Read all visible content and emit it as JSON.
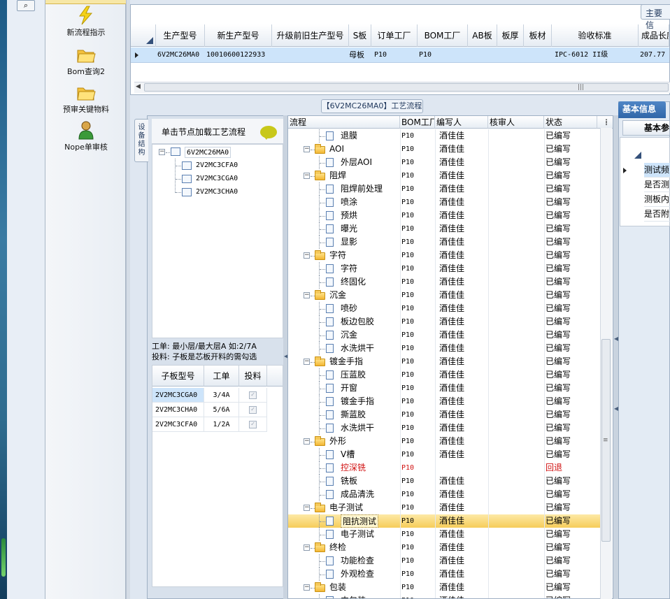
{
  "toolbar_top": {
    "icon": "binoculars-icon"
  },
  "nav": {
    "items": [
      {
        "label": "新流程指示",
        "icon": "lightning-icon"
      },
      {
        "label": "Bom查询2",
        "icon": "folder-open-icon"
      },
      {
        "label": "预审关键物料",
        "icon": "folder-open-icon"
      },
      {
        "label": "Nope单审核",
        "icon": "user-icon"
      }
    ]
  },
  "top_grid": {
    "tab_label": "主要信",
    "columns": [
      "生产型号",
      "新生产型号",
      "升级前旧生产型号",
      "S板",
      "订单工厂",
      "BOM工厂",
      "AB板",
      "板厚",
      "板材",
      "验收标准",
      "成品长度"
    ],
    "row": {
      "生产型号": "6V2MC26MA0",
      "新生产型号": "10010600122933",
      "升级前旧生产型号": "",
      "S板": "母板",
      "订单工厂": "P10",
      "BOM工厂": "P10",
      "AB板": "",
      "板厚": "",
      "板材": "",
      "验收标准": "IPC-6012 II级",
      "成品长度": "207.77"
    }
  },
  "flow_title": "【6V2MC26MA0】工艺流程",
  "left_panel": {
    "vtab_label": "设备结构",
    "tree_header": "单击节点加载工艺流程",
    "tree": {
      "root": "6V2MC26MA0",
      "children": [
        "2V2MC3CFA0",
        "2V2MC3CGA0",
        "2V2MC3CHA0"
      ]
    },
    "note_line1": "工单: 最小层/最大层A 如:2/7A",
    "note_line2": "投料: 子板是芯板开料的需勾选",
    "sub_grid": {
      "columns": [
        "子板型号",
        "工单",
        "投料"
      ],
      "rows": [
        {
          "model": "2V2MC3CGA0",
          "order": "3/4A"
        },
        {
          "model": "2V2MC3CHA0",
          "order": "5/6A"
        },
        {
          "model": "2V2MC3CFA0",
          "order": "1/2A"
        }
      ]
    }
  },
  "flow_grid": {
    "columns": [
      "流程",
      "BOM工厂",
      "编写人",
      "核审人",
      "状态"
    ],
    "rows": [
      {
        "name": "退膜",
        "level": 2,
        "factory": "P10",
        "writer": "酒佳佳",
        "reviewer": "",
        "status": "已编写"
      },
      {
        "name": "AOI",
        "level": 1,
        "factory": "P10",
        "writer": "酒佳佳",
        "reviewer": "",
        "status": "已编写"
      },
      {
        "name": "外层AOI",
        "level": 2,
        "factory": "P10",
        "writer": "酒佳佳",
        "reviewer": "",
        "status": "已编写"
      },
      {
        "name": "阻焊",
        "level": 1,
        "factory": "P10",
        "writer": "酒佳佳",
        "reviewer": "",
        "status": "已编写"
      },
      {
        "name": "阻焊前处理",
        "level": 2,
        "factory": "P10",
        "writer": "酒佳佳",
        "reviewer": "",
        "status": "已编写"
      },
      {
        "name": "喷涂",
        "level": 2,
        "factory": "P10",
        "writer": "酒佳佳",
        "reviewer": "",
        "status": "已编写"
      },
      {
        "name": "预烘",
        "level": 2,
        "factory": "P10",
        "writer": "酒佳佳",
        "reviewer": "",
        "status": "已编写"
      },
      {
        "name": "曝光",
        "level": 2,
        "factory": "P10",
        "writer": "酒佳佳",
        "reviewer": "",
        "status": "已编写"
      },
      {
        "name": "显影",
        "level": 2,
        "factory": "P10",
        "writer": "酒佳佳",
        "reviewer": "",
        "status": "已编写"
      },
      {
        "name": "字符",
        "level": 1,
        "factory": "P10",
        "writer": "酒佳佳",
        "reviewer": "",
        "status": "已编写"
      },
      {
        "name": "字符",
        "level": 2,
        "factory": "P10",
        "writer": "酒佳佳",
        "reviewer": "",
        "status": "已编写"
      },
      {
        "name": "终固化",
        "level": 2,
        "factory": "P10",
        "writer": "酒佳佳",
        "reviewer": "",
        "status": "已编写"
      },
      {
        "name": "沉金",
        "level": 1,
        "factory": "P10",
        "writer": "酒佳佳",
        "reviewer": "",
        "status": "已编写"
      },
      {
        "name": "喷砂",
        "level": 2,
        "factory": "P10",
        "writer": "酒佳佳",
        "reviewer": "",
        "status": "已编写"
      },
      {
        "name": "板边包胶",
        "level": 2,
        "factory": "P10",
        "writer": "酒佳佳",
        "reviewer": "",
        "status": "已编写"
      },
      {
        "name": "沉金",
        "level": 2,
        "factory": "P10",
        "writer": "酒佳佳",
        "reviewer": "",
        "status": "已编写"
      },
      {
        "name": "水洗烘干",
        "level": 2,
        "factory": "P10",
        "writer": "酒佳佳",
        "reviewer": "",
        "status": "已编写"
      },
      {
        "name": "镀金手指",
        "level": 1,
        "factory": "P10",
        "writer": "酒佳佳",
        "reviewer": "",
        "status": "已编写"
      },
      {
        "name": "压蓝胶",
        "level": 2,
        "factory": "P10",
        "writer": "酒佳佳",
        "reviewer": "",
        "status": "已编写"
      },
      {
        "name": "开窗",
        "level": 2,
        "factory": "P10",
        "writer": "酒佳佳",
        "reviewer": "",
        "status": "已编写"
      },
      {
        "name": "镀金手指",
        "level": 2,
        "factory": "P10",
        "writer": "酒佳佳",
        "reviewer": "",
        "status": "已编写"
      },
      {
        "name": "撕蓝胶",
        "level": 2,
        "factory": "P10",
        "writer": "酒佳佳",
        "reviewer": "",
        "status": "已编写"
      },
      {
        "name": "水洗烘干",
        "level": 2,
        "factory": "P10",
        "writer": "酒佳佳",
        "reviewer": "",
        "status": "已编写"
      },
      {
        "name": "外形",
        "level": 1,
        "factory": "P10",
        "writer": "酒佳佳",
        "reviewer": "",
        "status": "已编写"
      },
      {
        "name": "V槽",
        "level": 2,
        "factory": "P10",
        "writer": "酒佳佳",
        "reviewer": "",
        "status": "已编写"
      },
      {
        "name": "控深铣",
        "level": 2,
        "factory": "P10",
        "writer": "",
        "reviewer": "",
        "status": "回退",
        "red": true
      },
      {
        "name": "铣板",
        "level": 2,
        "factory": "P10",
        "writer": "酒佳佳",
        "reviewer": "",
        "status": "已编写"
      },
      {
        "name": "成品清洗",
        "level": 2,
        "factory": "P10",
        "writer": "酒佳佳",
        "reviewer": "",
        "status": "已编写"
      },
      {
        "name": "电子测试",
        "level": 1,
        "factory": "P10",
        "writer": "酒佳佳",
        "reviewer": "",
        "status": "已编写"
      },
      {
        "name": "阻抗测试",
        "level": 2,
        "factory": "P10",
        "writer": "酒佳佳",
        "reviewer": "",
        "status": "已编写",
        "selected": true
      },
      {
        "name": "电子测试",
        "level": 2,
        "factory": "P10",
        "writer": "酒佳佳",
        "reviewer": "",
        "status": "已编写"
      },
      {
        "name": "终检",
        "level": 1,
        "factory": "P10",
        "writer": "酒佳佳",
        "reviewer": "",
        "status": "已编写"
      },
      {
        "name": "功能检查",
        "level": 2,
        "factory": "P10",
        "writer": "酒佳佳",
        "reviewer": "",
        "status": "已编写"
      },
      {
        "name": "外观检查",
        "level": 2,
        "factory": "P10",
        "writer": "酒佳佳",
        "reviewer": "",
        "status": "已编写"
      },
      {
        "name": "包装",
        "level": 1,
        "factory": "P10",
        "writer": "酒佳佳",
        "reviewer": "",
        "status": "已编写"
      },
      {
        "name": "内包装",
        "level": 2,
        "factory": "P10",
        "writer": "酒佳佳",
        "reviewer": "",
        "status": "已编写"
      }
    ]
  },
  "right_panel": {
    "tab_label": "基本信息",
    "sub_label": "基本参",
    "rows": [
      "测试频",
      "是否测",
      "测板内",
      "是否附"
    ]
  }
}
